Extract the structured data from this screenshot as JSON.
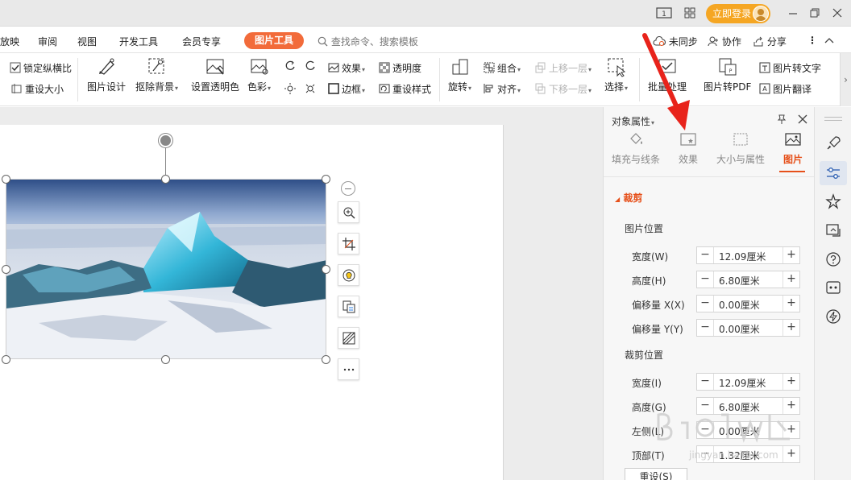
{
  "titlebar": {
    "login_label": "立即登录"
  },
  "menubar": {
    "items": [
      "放映",
      "审阅",
      "视图",
      "开发工具",
      "会员专享"
    ],
    "active_tab": "图片工具",
    "search_placeholder": "查找命令、搜索模板",
    "right_items": [
      "未同步",
      "协作",
      "分享"
    ]
  },
  "ribbon": {
    "lock_ratio": "锁定纵横比",
    "reset_size": "重设大小",
    "picture_design": "图片设计",
    "remove_bg": "抠除背景",
    "set_transparent": "设置透明色",
    "color": "色彩",
    "effects": "效果",
    "transparency": "透明度",
    "border": "边框",
    "reset_style": "重设样式",
    "rotate": "旋转",
    "group": "组合",
    "align": "对齐",
    "bring_forward": "上移一层",
    "send_backward": "下移一层",
    "select": "选择",
    "batch_process": "批量处理",
    "to_pdf": "图片转PDF",
    "to_text": "图片转文字",
    "translate": "图片翻译"
  },
  "panel": {
    "title": "对象属性",
    "tabs": [
      {
        "label": "填充与线条",
        "icon": "fill-bucket-icon"
      },
      {
        "label": "效果",
        "icon": "effects-icon"
      },
      {
        "label": "大小与属性",
        "icon": "size-icon"
      },
      {
        "label": "图片",
        "icon": "picture-icon"
      }
    ],
    "section": "裁剪",
    "picture_position": {
      "heading": "图片位置",
      "rows": [
        {
          "label": "宽度(W)",
          "value": "12.09厘米"
        },
        {
          "label": "高度(H)",
          "value": "6.80厘米"
        },
        {
          "label": "偏移量 X(X)",
          "value": "0.00厘米"
        },
        {
          "label": "偏移量 Y(Y)",
          "value": "0.00厘米"
        }
      ]
    },
    "crop_position": {
      "heading": "裁剪位置",
      "rows": [
        {
          "label": "宽度(I)",
          "value": "12.09厘米"
        },
        {
          "label": "高度(G)",
          "value": "6.80厘米"
        },
        {
          "label": "左侧(L)",
          "value": "0.00厘米"
        },
        {
          "label": "顶部(T)",
          "value": "1.32厘米"
        }
      ]
    },
    "reset_label": "重设(S)"
  },
  "colors": {
    "accent": "#f26b3a",
    "panel_accent": "#e6501a",
    "login": "#f5a623",
    "arrow": "#e8231b"
  }
}
